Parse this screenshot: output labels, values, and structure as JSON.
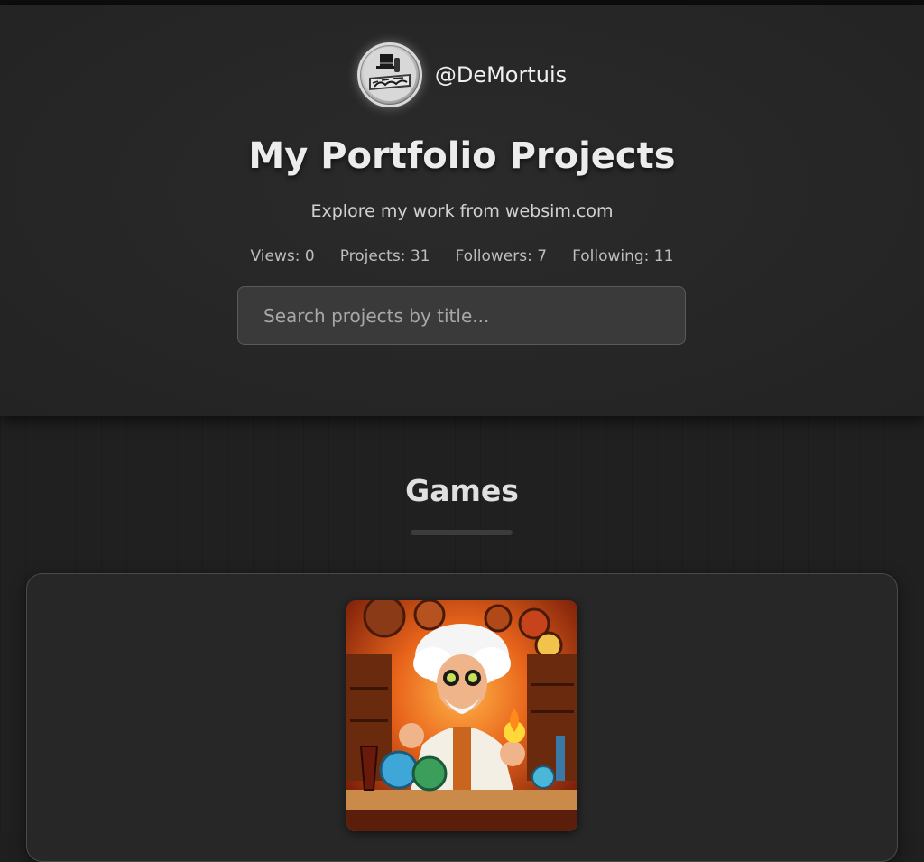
{
  "profile": {
    "username": "@DeMortuis",
    "avatar_icon": "top-hat-logo-icon"
  },
  "header": {
    "title": "My Portfolio Projects",
    "subtitle": "Explore my work from websim.com"
  },
  "stats": {
    "views": "Views: 0",
    "projects": "Projects: 31",
    "followers": "Followers: 7",
    "following": "Following: 11"
  },
  "search": {
    "placeholder": "Search projects by title..."
  },
  "sections": [
    {
      "title": "Games",
      "projects": [
        {
          "thumbnail_icon": "mad-scientist-illustration"
        }
      ]
    }
  ],
  "colors": {
    "background": "#1f1f1f",
    "header": "#262626",
    "card": "#272727",
    "text": "#ececec"
  }
}
